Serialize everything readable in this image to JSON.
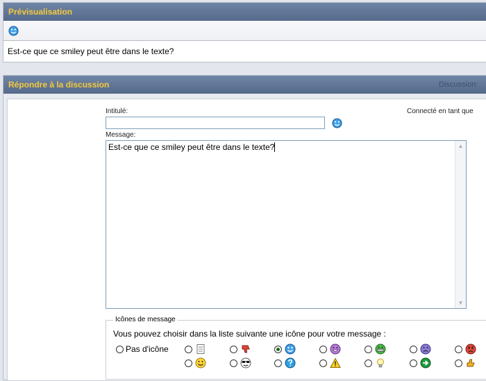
{
  "preview": {
    "title": "Prévisualisation",
    "body_text": "Est-ce que ce smiley peut être dans le texte?"
  },
  "reply": {
    "title": "Répondre à la discussion",
    "header_right_text": "Discussion: ",
    "logged_in_text": "Connecté en tant que",
    "title_label": "Intitulé:",
    "title_value": "",
    "message_label": "Message:",
    "message_value": "Est-ce que ce smiley peut être dans le texte?",
    "icons": {
      "legend": "Icônes de message",
      "instructions": "Vous pouvez choisir dans la liste suivante une icône pour votre message :",
      "none_label": "Pas d'icône",
      "selected": "smile-blue",
      "options_row1": [
        "document-icon",
        "thumbs-down-icon",
        "smile-blue-icon",
        "purple-grin-icon",
        "green-teeth-icon",
        "sad-purple-icon",
        "angry-red-icon"
      ],
      "options_row2": [
        "yellow-smile-icon",
        "cool-sunglasses-icon",
        "question-icon",
        "warning-icon",
        "lightbulb-icon",
        "arrow-right-icon",
        "thumbs-up-icon"
      ]
    }
  }
}
